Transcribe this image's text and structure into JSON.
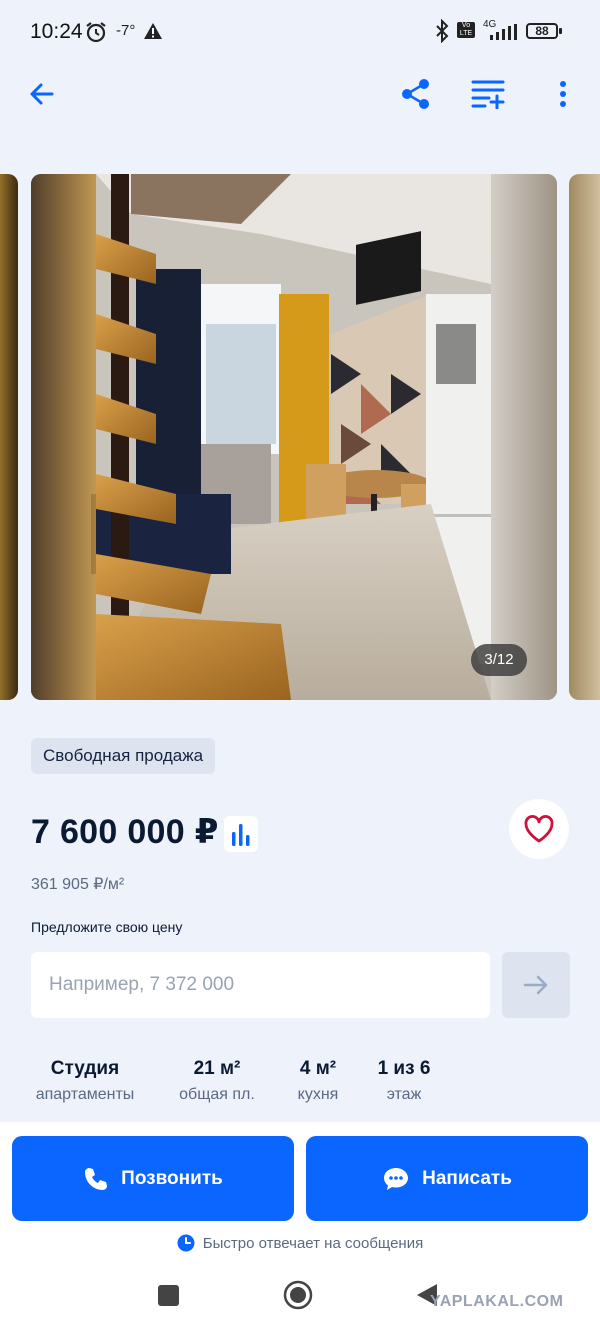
{
  "status_bar": {
    "time": "10:24",
    "temperature": "-7°",
    "network": "4G",
    "volte": "Vo LTE",
    "battery": "88"
  },
  "toolbar": {
    "back_icon": "arrow-left-icon",
    "share_icon": "share-icon",
    "add_to_list_icon": "playlist-add-icon",
    "more_icon": "more-vertical-icon"
  },
  "gallery": {
    "counter": "3/12"
  },
  "listing": {
    "badge": "Свободная продажа",
    "price": "7 600 000 ₽",
    "price_per_m2": "361 905 ₽/м²",
    "offer_label": "Предложите свою цену",
    "offer_placeholder": "Например, 7 372 000",
    "facts": [
      {
        "value": "Студия",
        "label": "апартаменты"
      },
      {
        "value": "21 м²",
        "label": "общая пл."
      },
      {
        "value": "4 м²",
        "label": "кухня"
      },
      {
        "value": "1 из 6",
        "label": "этаж"
      }
    ]
  },
  "actions": {
    "call_label": "Позвонить",
    "write_label": "Написать",
    "fast_reply": "Быстро отвечает на сообщения"
  },
  "watermark": "YAPLAKAL.COM",
  "colors": {
    "accent": "#0a66ff",
    "background": "#eef2fb",
    "favorite": "#d0103a"
  }
}
